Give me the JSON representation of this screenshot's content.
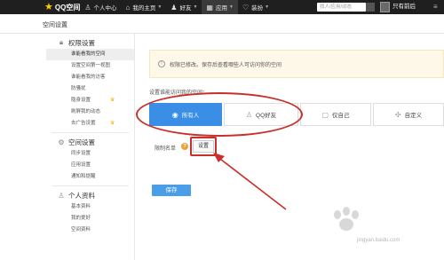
{
  "topbar": {
    "logo": "QQ空间",
    "nav": [
      {
        "label": "个人中心",
        "icon": "person-icon"
      },
      {
        "label": "我的主页",
        "icon": "home-icon"
      },
      {
        "label": "好友",
        "icon": "friends-icon"
      },
      {
        "label": "应用",
        "icon": "apps-icon"
      },
      {
        "label": "装扮",
        "icon": "shirt-icon"
      }
    ],
    "search_placeholder": "找人/应用/动态",
    "username": "只有前后"
  },
  "page": {
    "title": "空间设置"
  },
  "sidebar": {
    "groups": [
      {
        "label": "权限设置",
        "icon": "lock-icon",
        "items": [
          {
            "label": "谁能看我的空间",
            "active": true,
            "crown": false
          },
          {
            "label": "设置空间第一视图",
            "active": false,
            "crown": false
          },
          {
            "label": "谁能看我的访客",
            "active": false,
            "crown": false
          },
          {
            "label": "防骚扰",
            "active": false,
            "crown": false
          },
          {
            "label": "隐身设置",
            "active": false,
            "crown": true
          },
          {
            "label": "刷屏我的动态",
            "active": false,
            "crown": false
          },
          {
            "label": "去广告设置",
            "active": false,
            "crown": true
          }
        ]
      },
      {
        "label": "空间设置",
        "icon": "gear-icon",
        "items": [
          {
            "label": "同步设置",
            "active": false,
            "crown": false
          },
          {
            "label": "应用设置",
            "active": false,
            "crown": false
          },
          {
            "label": "通知和提醒",
            "active": false,
            "crown": false
          }
        ]
      },
      {
        "label": "个人资料",
        "icon": "people-icon",
        "items": [
          {
            "label": "基本资料",
            "active": false,
            "crown": false
          },
          {
            "label": "我的爱好",
            "active": false,
            "crown": false
          },
          {
            "label": "空间资料",
            "active": false,
            "crown": false
          }
        ]
      }
    ]
  },
  "notice": {
    "text": "权限已修改。保存后查看哪些人可访问你的空间"
  },
  "access": {
    "label": "设置谁能访问我的空间：",
    "options": [
      {
        "label": "所有人",
        "icon": "globe-icon",
        "selected": true
      },
      {
        "label": "QQ好友",
        "icon": "friend-icon",
        "selected": false
      },
      {
        "label": "仅自己",
        "icon": "lock-icon",
        "selected": false
      },
      {
        "label": "自定义",
        "icon": "custom-icon",
        "selected": false
      }
    ]
  },
  "restrict": {
    "label": "限制名单",
    "help": "?",
    "button": "设置"
  },
  "save_label": "保存",
  "watermark": "jingyan.baidu.com",
  "colors": {
    "topbar": "#1f1f1f",
    "accent": "#3a8ee6",
    "annotation": "#c9302c",
    "notice_bg": "#fdf8e8"
  }
}
